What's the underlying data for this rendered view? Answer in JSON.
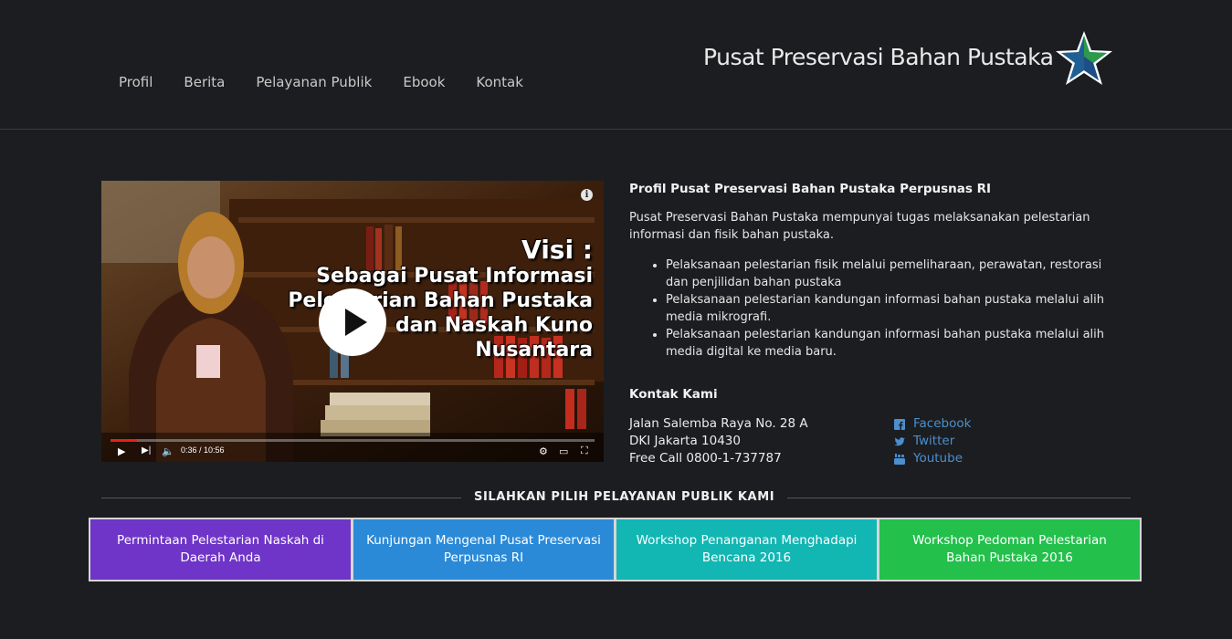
{
  "nav": {
    "items": [
      {
        "label": "Profil"
      },
      {
        "label": "Berita"
      },
      {
        "label": "Pelayanan Publik"
      },
      {
        "label": "Ebook"
      },
      {
        "label": "Kontak"
      }
    ]
  },
  "brand": {
    "title": "Pusat Preservasi Bahan Pustaka",
    "logo_icon": "star-logo-icon"
  },
  "video": {
    "overlay_lines": [
      "Visi :",
      "Sebagai Pusat Informasi",
      "Pelestarian Bahan Pustaka",
      "dan Naskah Kuno",
      "Nusantara"
    ],
    "time": "0:36 / 10:56",
    "progress": 0.055,
    "colors": {
      "progress": "#e62117"
    }
  },
  "profile": {
    "heading": "Profil Pusat Preservasi Bahan Pustaka Perpusnas RI",
    "intro": "Pusat Preservasi Bahan Pustaka mempunyai tugas melaksanakan pelestarian informasi dan fisik bahan pustaka.",
    "bullets": [
      "Pelaksanaan pelestarian fisik melalui pemeliharaan, perawatan, restorasi dan penjilidan bahan pustaka",
      "Pelaksanaan pelestarian kandungan informasi bahan pustaka melalui alih media mikrografi.",
      "Pelaksanaan pelestarian kandungan informasi bahan pustaka melalui alih media digital ke media baru."
    ]
  },
  "contact": {
    "heading": "Kontak Kami",
    "address": [
      "Jalan Salemba Raya No. 28 A",
      "DKI Jakarta 10430",
      "Free Call 0800-1-737787"
    ],
    "social": [
      {
        "label": "Facebook",
        "icon": "facebook-icon"
      },
      {
        "label": "Twitter",
        "icon": "twitter-icon"
      },
      {
        "label": "Youtube",
        "icon": "youtube-icon"
      }
    ],
    "link_color": "#4b8fce"
  },
  "services": {
    "heading": "SILAHKAN PILIH PELAYANAN PUBLIK KAMI",
    "tiles": [
      {
        "label": "Permintaan Pelestarian Naskah di Daerah Anda",
        "color": "#6f34c8"
      },
      {
        "label": "Kunjungan Mengenal Pusat Preservasi Perpusnas RI",
        "color": "#2a8ad8"
      },
      {
        "label": "Workshop Penanganan Menghadapi Bencana 2016",
        "color": "#12b6b2"
      },
      {
        "label": "Workshop Pedoman Pelestarian Bahan Pustaka 2016",
        "color": "#23c04c"
      }
    ]
  }
}
